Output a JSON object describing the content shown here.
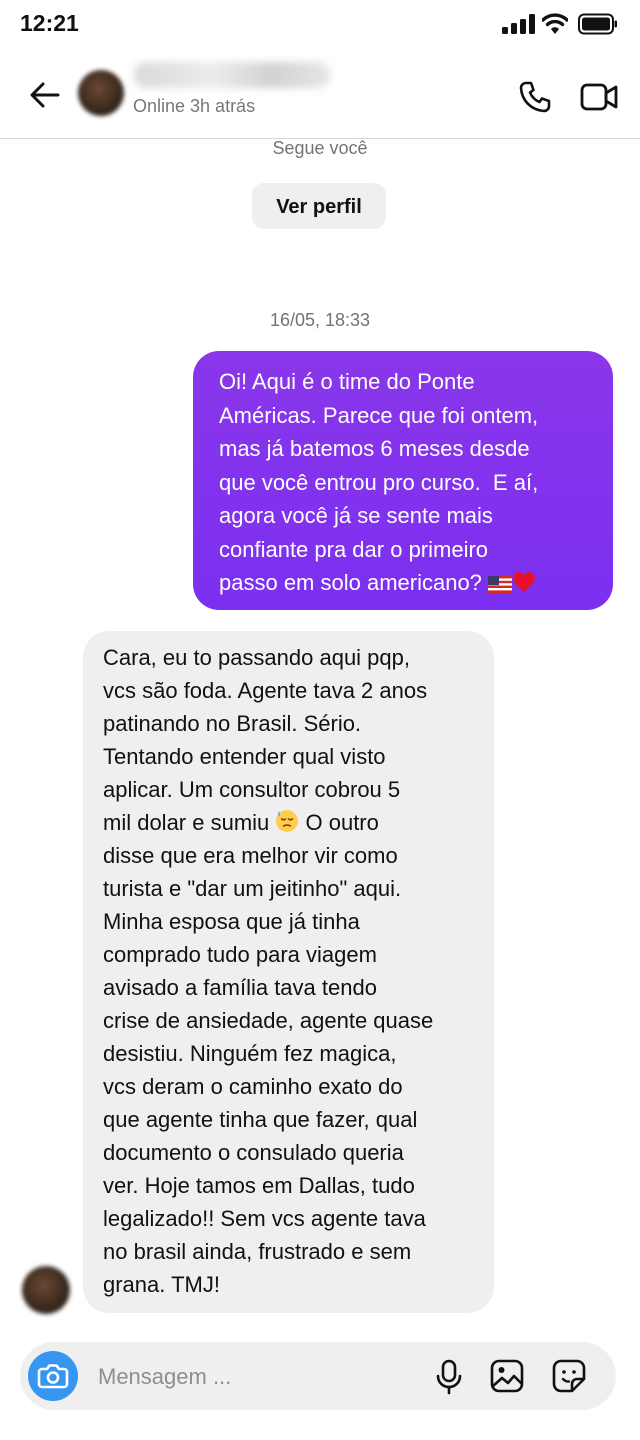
{
  "status_bar": {
    "time": "12:21",
    "icons": [
      "signal-icon",
      "wifi-icon",
      "battery-icon"
    ]
  },
  "header": {
    "status": "Online 3h atrás",
    "icons": [
      "back-arrow-icon",
      "phone-icon",
      "video-camera-icon"
    ]
  },
  "thread": {
    "follows_you": "Segue você",
    "view_profile_label": "Ver perfil",
    "timestamp": "16/05, 18:33"
  },
  "messages": {
    "outgoing": {
      "lines": [
        "Oi! Aqui é o time do Ponte",
        "Américas. Parece que foi ontem,",
        "mas já batemos 6 meses desde",
        "que você entrou pro curso.  E aí,",
        "agora você já se sente mais",
        "confiante pra dar o primeiro",
        "passo em solo americano? "
      ],
      "trailing_emojis": [
        "us-flag-emoji",
        "red-heart-emoji"
      ]
    },
    "incoming": {
      "lines": [
        "Cara, eu to passando aqui pqp,",
        "vcs são foda. Agente tava 2 anos",
        "patinando no Brasil. Sério.",
        "Tentando entender qual visto",
        "aplicar. Um consultor cobrou 5",
        "mil dolar e sumiu ",
        "disse que era melhor vir como",
        "turista e \"dar um jeitinho\" aqui.",
        "Minha esposa que já tinha",
        "comprado tudo para viagem",
        "avisado a família tava tendo",
        "crise de ansiedade, agente quase",
        "desistiu. Ninguém fez magica,",
        "vcs deram o caminho exato do",
        "que agente tinha que fazer, qual",
        "documento o consulado queria",
        "ver. Hoje tamos em Dallas, tudo",
        "legalizado!! Sem vcs agente tava",
        "no brasil ainda, frustrado e sem",
        "grana. TMJ!"
      ],
      "line6_after_emoji": " O outro",
      "inline_emoji": "downcast-sweat-emoji"
    }
  },
  "composer": {
    "placeholder": "Mensagem ...",
    "icons": [
      "camera-icon",
      "microphone-icon",
      "gallery-icon",
      "sticker-icon"
    ],
    "camera_color": "#3797f0"
  },
  "colors": {
    "outgoing_bubble": "#7b2ff0",
    "incoming_bubble": "#efefef",
    "secondary_text": "#737373"
  }
}
